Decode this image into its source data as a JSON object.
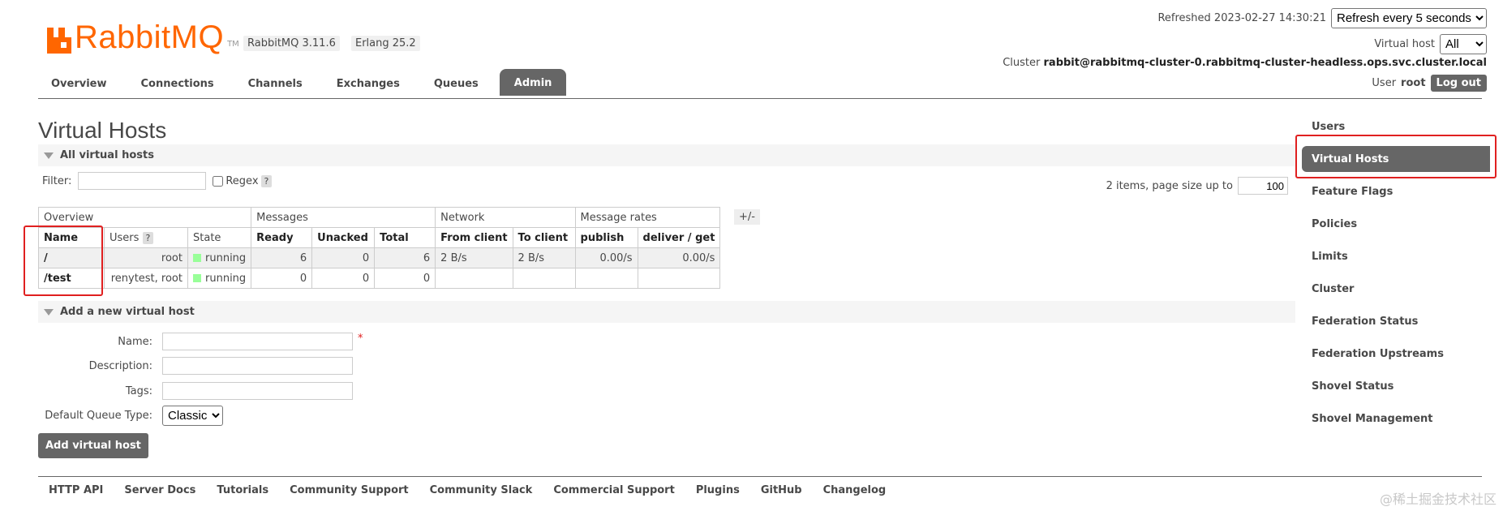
{
  "header": {
    "logo_text_rabbit": "Rabbit",
    "logo_text_mq": "MQ",
    "logo_tm": "TM",
    "version": "RabbitMQ 3.11.6",
    "erlang": "Erlang 25.2",
    "refreshed_label": "Refreshed 2023-02-27 14:30:21",
    "refresh_select": "Refresh every 5 seconds",
    "vhost_label": "Virtual host",
    "vhost_select": "All",
    "cluster_label": "Cluster",
    "cluster_name": "rabbit@rabbitmq-cluster-0.rabbitmq-cluster-headless.ops.svc.cluster.local",
    "user_label": "User",
    "user_name": "root",
    "logout": "Log out"
  },
  "tabs": [
    "Overview",
    "Connections",
    "Channels",
    "Exchanges",
    "Queues",
    "Admin"
  ],
  "active_tab": "Admin",
  "page_title": "Virtual Hosts",
  "all_vhosts": {
    "section_title": "All virtual hosts",
    "filter_label": "Filter:",
    "regex_label": "Regex",
    "help": "?",
    "page_info": "2 items, page size up to",
    "page_size": "100",
    "plusminus": "+/-",
    "group_headers": [
      "Overview",
      "Messages",
      "Network",
      "Message rates"
    ],
    "columns": [
      "Name",
      "Users",
      "State",
      "Ready",
      "Unacked",
      "Total",
      "From client",
      "To client",
      "publish",
      "deliver / get"
    ],
    "users_help": "?",
    "rows": [
      {
        "name": "/",
        "users": "root",
        "state": "running",
        "ready": "6",
        "unacked": "0",
        "total": "6",
        "from_client": "2 B/s",
        "to_client": "2 B/s",
        "publish": "0.00/s",
        "deliver_get": "0.00/s"
      },
      {
        "name": "/test",
        "users": "renytest, root",
        "state": "running",
        "ready": "0",
        "unacked": "0",
        "total": "0",
        "from_client": "",
        "to_client": "",
        "publish": "",
        "deliver_get": ""
      }
    ]
  },
  "add_vhost": {
    "section_title": "Add a new virtual host",
    "name_label": "Name:",
    "required_mark": "*",
    "description_label": "Description:",
    "tags_label": "Tags:",
    "queue_type_label": "Default Queue Type:",
    "queue_type_value": "Classic",
    "button": "Add virtual host"
  },
  "footer": [
    "HTTP API",
    "Server Docs",
    "Tutorials",
    "Community Support",
    "Community Slack",
    "Commercial Support",
    "Plugins",
    "GitHub",
    "Changelog"
  ],
  "sidebar": [
    "Users",
    "Virtual Hosts",
    "Feature Flags",
    "Policies",
    "Limits",
    "Cluster",
    "Federation Status",
    "Federation Upstreams",
    "Shovel Status",
    "Shovel Management"
  ],
  "sidebar_active": "Virtual Hosts",
  "watermark": "@稀土掘金技术社区",
  "colors": {
    "brand": "#ff6600",
    "dark": "#666666",
    "highlight": "#e02020",
    "running": "#99ff99"
  }
}
